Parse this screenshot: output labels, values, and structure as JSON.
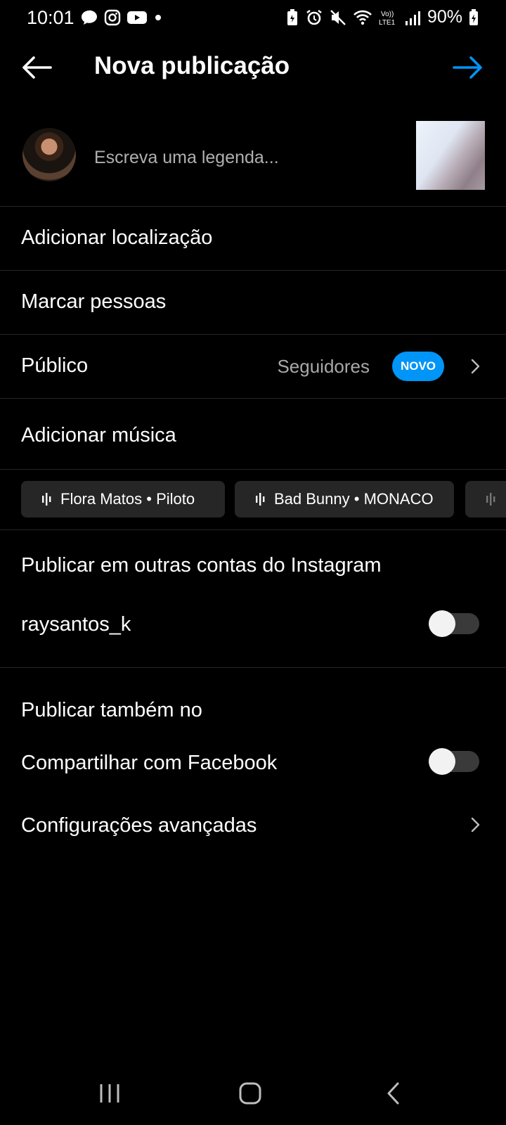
{
  "status_bar": {
    "time": "10:01",
    "battery": "90%",
    "left_icons": [
      "chat-bubble-icon",
      "instagram-icon",
      "youtube-icon",
      "dot-icon"
    ],
    "right_icons": [
      "battery-saver-icon",
      "alarm-icon",
      "mute-icon",
      "wifi-icon",
      "volte-icon",
      "signal-icon",
      "battery-icon"
    ]
  },
  "header": {
    "title": "Nova publicação",
    "back_icon": "arrow-left-icon",
    "next_icon": "arrow-right-icon"
  },
  "caption": {
    "placeholder": "Escreva uma legenda...",
    "value": ""
  },
  "rows": {
    "location": "Adicionar localização",
    "tag_people": "Marcar pessoas",
    "audience_label": "Público",
    "audience_value": "Seguidores",
    "audience_badge": "NOVO",
    "add_music": "Adicionar música"
  },
  "music_suggestions": [
    {
      "label": "Flora Matos • Piloto"
    },
    {
      "label": "Bad Bunny • MONACO"
    }
  ],
  "other_accounts": {
    "title": "Publicar em outras contas do Instagram",
    "account": "raysantos_k",
    "enabled": false
  },
  "also_post": {
    "title": "Publicar também no",
    "facebook_label": "Compartilhar com Facebook",
    "facebook_enabled": false
  },
  "advanced": {
    "label": "Configurações avançadas"
  },
  "colors": {
    "accent": "#0095f6",
    "background": "#000000",
    "divider": "#262626",
    "chip": "#262626"
  }
}
